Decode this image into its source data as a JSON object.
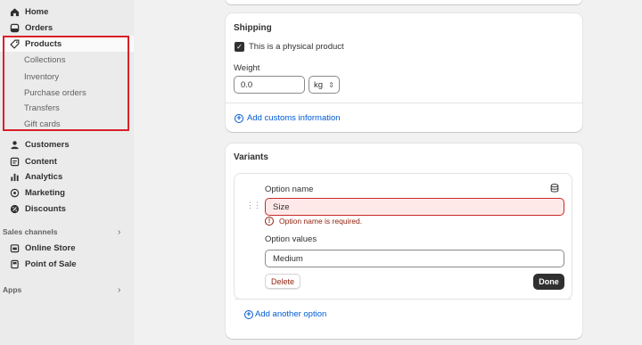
{
  "sidebar": {
    "items": [
      {
        "label": "Home",
        "icon": "home-icon"
      },
      {
        "label": "Orders",
        "icon": "orders-icon"
      },
      {
        "label": "Products",
        "icon": "tag-icon"
      },
      {
        "label": "Customers",
        "icon": "person-icon"
      },
      {
        "label": "Content",
        "icon": "content-icon"
      },
      {
        "label": "Analytics",
        "icon": "analytics-icon"
      },
      {
        "label": "Marketing",
        "icon": "marketing-icon"
      },
      {
        "label": "Discounts",
        "icon": "discount-icon"
      }
    ],
    "product_subitems": [
      "Collections",
      "Inventory",
      "Purchase orders",
      "Transfers",
      "Gift cards"
    ],
    "sales_channels_label": "Sales channels",
    "channels": [
      {
        "label": "Online Store",
        "icon": "store-icon"
      },
      {
        "label": "Point of Sale",
        "icon": "pos-icon"
      }
    ],
    "apps_label": "Apps",
    "highlight_color": "#d9202a"
  },
  "shipping": {
    "title": "Shipping",
    "physical_label": "This is a physical product",
    "physical_checked": true,
    "weight_label": "Weight",
    "weight_value": "0.0",
    "unit": "kg",
    "customs_link": "Add customs information"
  },
  "variants": {
    "title": "Variants",
    "option_name_label": "Option name",
    "option_name_value": "Size",
    "error": "Option name is required.",
    "option_values_label": "Option values",
    "option_value": "Medium",
    "delete_label": "Delete",
    "done_label": "Done",
    "add_another": "Add another option"
  }
}
